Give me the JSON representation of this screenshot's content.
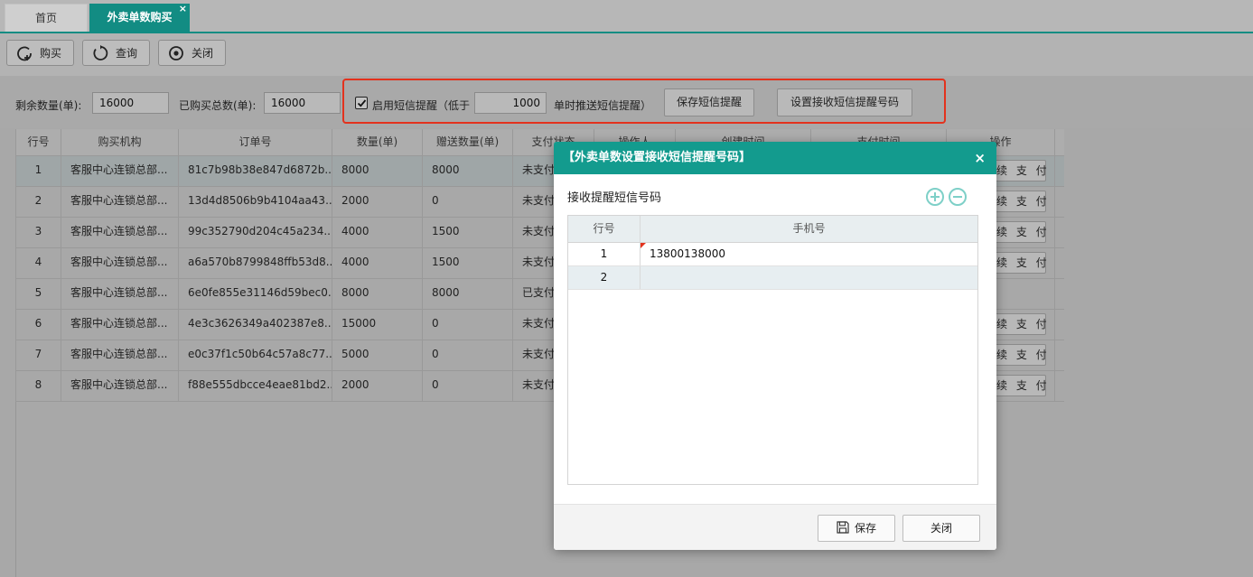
{
  "tabs": [
    {
      "label": "首页"
    },
    {
      "label": "外卖单数购买",
      "close": "×"
    }
  ],
  "toolbar": {
    "buy_label": "购买",
    "query_label": "查询",
    "close_label": "关闭"
  },
  "filters": {
    "remaining_label": "剩余数量(单):",
    "remaining_value": "16000",
    "total_label": "已购买总数(单):",
    "total_value": "16000",
    "sms_enable_label": "启用短信提醒（低于",
    "sms_enabled": true,
    "threshold_value": "1000",
    "sms_suffix": "单时推送短信提醒）",
    "save_sms_label": "保存短信提醒",
    "set_phone_label": "设置接收短信提醒号码"
  },
  "grid": {
    "columns": [
      "行号",
      "购买机构",
      "订单号",
      "数量(单)",
      "赠送数量(单)",
      "支付状态",
      "操作人",
      "创建时间",
      "支付时间",
      "操作"
    ],
    "pay_label": "续 支 付",
    "rows": [
      {
        "no": "1",
        "org": "客服中心连锁总部...",
        "order": "81c7b98b38e847d6872b...",
        "qty": "8000",
        "gift": "8000",
        "status": "未支付",
        "pay": true
      },
      {
        "no": "2",
        "org": "客服中心连锁总部...",
        "order": "13d4d8506b9b4104aa43...",
        "qty": "2000",
        "gift": "0",
        "status": "未支付",
        "pay": true
      },
      {
        "no": "3",
        "org": "客服中心连锁总部...",
        "order": "99c352790d204c45a234...",
        "qty": "4000",
        "gift": "1500",
        "status": "未支付",
        "pay": true
      },
      {
        "no": "4",
        "org": "客服中心连锁总部...",
        "order": "a6a570b8799848ffb53d8...",
        "qty": "4000",
        "gift": "1500",
        "status": "未支付",
        "pay": true
      },
      {
        "no": "5",
        "org": "客服中心连锁总部...",
        "order": "6e0fe855e31146d59bec0...",
        "qty": "8000",
        "gift": "8000",
        "status": "已支付",
        "pay": false
      },
      {
        "no": "6",
        "org": "客服中心连锁总部...",
        "order": "4e3c3626349a402387e8...",
        "qty": "15000",
        "gift": "0",
        "status": "未支付",
        "pay": true
      },
      {
        "no": "7",
        "org": "客服中心连锁总部...",
        "order": "e0c37f1c50b64c57a8c77...",
        "qty": "5000",
        "gift": "0",
        "status": "未支付",
        "pay": true
      },
      {
        "no": "8",
        "org": "客服中心连锁总部...",
        "order": "f88e555dbcce4eae81bd2...",
        "qty": "2000",
        "gift": "0",
        "status": "未支付",
        "pay": true
      }
    ]
  },
  "modal": {
    "title": "【外卖单数设置接收短信提醒号码】",
    "close": "×",
    "section_label": "接收提醒短信号码",
    "columns": [
      "行号",
      "手机号"
    ],
    "rows": [
      {
        "no": "1",
        "phone": "13800138000"
      },
      {
        "no": "2",
        "phone": ""
      }
    ],
    "save_label": "保存",
    "close_label": "关闭"
  },
  "colors": {
    "accent": "#139b8e",
    "highlight_border": "#e3321d"
  }
}
